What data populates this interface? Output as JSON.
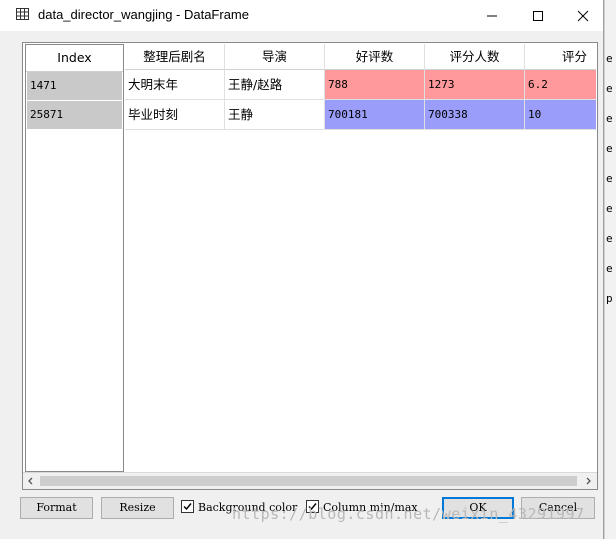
{
  "window": {
    "title": "data_director_wangjing - DataFrame"
  },
  "table": {
    "index_header": "Index",
    "columns": [
      "整理后剧名",
      "导演",
      "好评数",
      "评分人数",
      "评分"
    ],
    "rows": [
      {
        "index": "1471",
        "cells": [
          "大明末年",
          "王静/赵路",
          "788",
          "1273",
          "6.2"
        ]
      },
      {
        "index": "25871",
        "cells": [
          "毕业时刻",
          "王静",
          "700181",
          "700338",
          "10"
        ]
      }
    ],
    "row_colors": [
      "#ff999c",
      "#9b9dfa"
    ]
  },
  "buttons": {
    "format": "Format",
    "resize": "Resize",
    "ok": "OK",
    "cancel": "Cancel"
  },
  "checkboxes": {
    "background_color": {
      "label": "Background color",
      "checked": true
    },
    "column_min_max": {
      "label": "Column min/max",
      "checked": true
    }
  },
  "watermark": "https://blog.csdn.net/weixin_43291997",
  "background_editor_chars": [
    "e",
    "e",
    "e",
    "e",
    "e",
    "e",
    "e",
    "e",
    "p"
  ]
}
